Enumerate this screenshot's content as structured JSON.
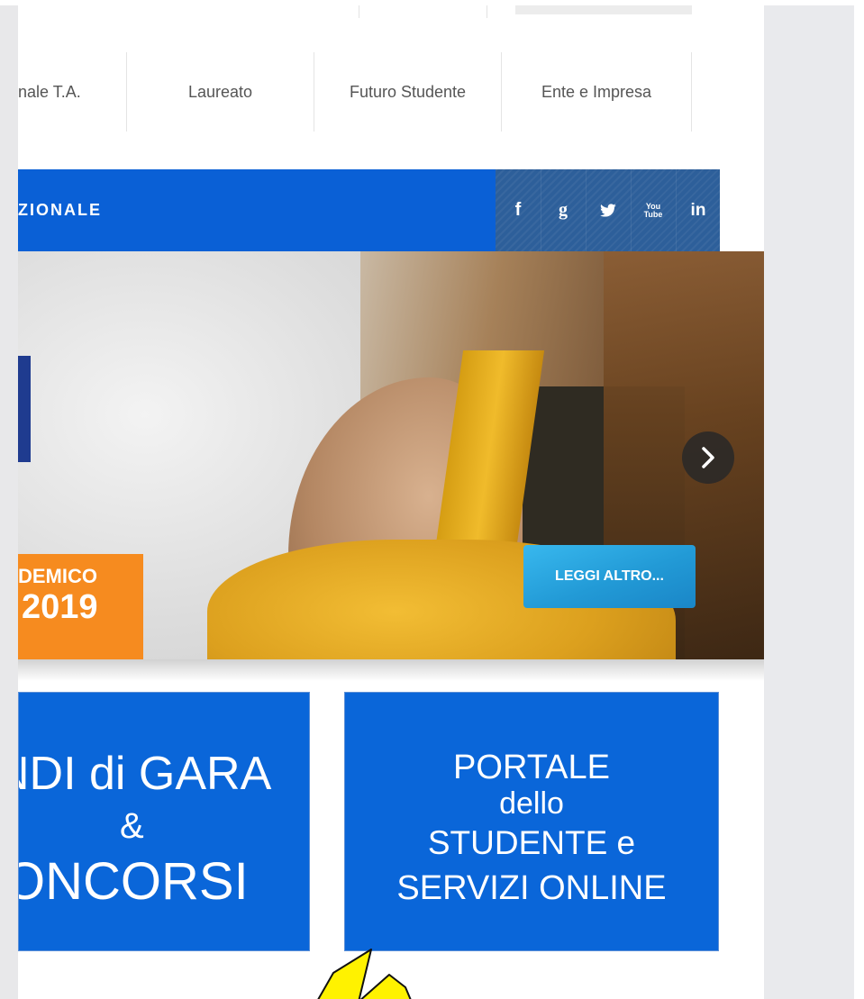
{
  "top_nav": {
    "items": [
      {
        "label": "nale T.A."
      },
      {
        "label": "Laureato"
      },
      {
        "label": "Futuro Studente"
      },
      {
        "label": "Ente e Impresa"
      }
    ]
  },
  "blue_bar": {
    "label": "ZIONALE"
  },
  "social": {
    "icons": [
      {
        "name": "facebook-icon",
        "glyph": "f"
      },
      {
        "name": "google-icon",
        "glyph": "g"
      },
      {
        "name": "twitter-icon",
        "glyph": "✉"
      },
      {
        "name": "youtube-icon",
        "glyph": "You Tube"
      },
      {
        "name": "linkedin-icon",
        "glyph": "in"
      }
    ]
  },
  "hero": {
    "tag_line1": "DEMICO",
    "tag_line2": "2019",
    "button_label": "LEGGI ALTRO..."
  },
  "tiles": {
    "left": {
      "line1": "NDI di GARA",
      "line2": "&",
      "line3": "ONCORSI"
    },
    "right": {
      "line1": "PORTALE",
      "line2": "dello",
      "line3": "STUDENTE e",
      "line4": "SERVIZI ONLINE"
    }
  },
  "colors": {
    "brand_blue": "#0a60d6",
    "social_bar": "#2d5f9a",
    "orange": "#f68b1f",
    "button_blue": "#229ad6",
    "arrow_yellow": "#fff200"
  }
}
